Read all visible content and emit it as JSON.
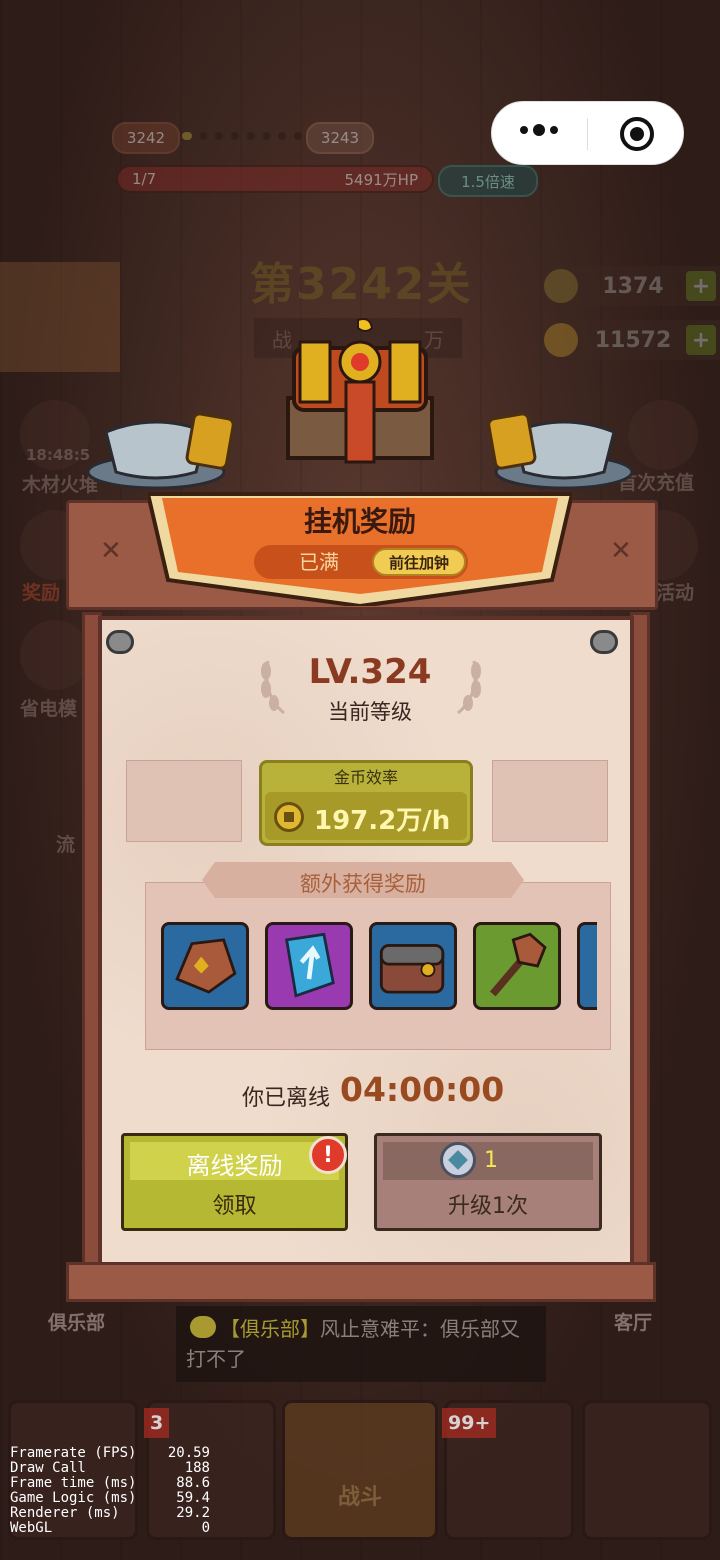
{
  "hud": {
    "level_current": "3242",
    "level_next": "3243",
    "wave": "1/7",
    "hp": "5491万HP",
    "speed": "1.5倍速",
    "stage_title": "第3242关",
    "stage_sub_left": "战",
    "stage_sub_right": "万",
    "currency_gold": "1374",
    "currency_bone": "11572",
    "side_left": [
      {
        "label": "木材火堆",
        "timer": "18:48:5"
      },
      {
        "label": "奖励"
      },
      {
        "label": "省电模"
      },
      {
        "label": "流"
      }
    ],
    "side_right": [
      {
        "label": "首次充值"
      },
      {
        "label": "活动"
      }
    ]
  },
  "modal": {
    "title": "挂机奖励",
    "full_label": "已满",
    "clock_button": "前往加钟",
    "level": "LV.324",
    "level_sub": "当前等级",
    "gold_rate_label": "金币效率",
    "gold_rate_value": "197.2万/h",
    "extra_title": "额外获得奖励",
    "items": [
      {
        "name": "ore-icon",
        "bg": "#2a6aa0"
      },
      {
        "name": "rune-stone-icon",
        "bg": "#9a3ab0"
      },
      {
        "name": "treasure-chest-icon",
        "bg": "#2a6aa0"
      },
      {
        "name": "torch-icon",
        "bg": "#6a9a30"
      },
      {
        "name": "partial-item-icon",
        "bg": "#2a6aa0"
      }
    ],
    "offline_label": "你已离线",
    "offline_time": "04:00:00",
    "offline_reward_label": "离线奖励",
    "claim_label": "领取",
    "alert_mark": "!",
    "gem_count": "1",
    "upgrade_label": "升级1次"
  },
  "bottom": {
    "club_label": "俱乐部",
    "lobby_label": "客厅",
    "chat_tag": "【俱乐部】",
    "chat_text": "风止意难平：俱乐部又打不了",
    "nav_badge_left": "3",
    "nav_battle": "战斗",
    "nav_badge_right": "99+"
  },
  "debug": [
    {
      "k": "Framerate (FPS)",
      "v": "20.59"
    },
    {
      "k": "Draw Call",
      "v": "188"
    },
    {
      "k": "Frame time (ms)",
      "v": "88.6"
    },
    {
      "k": "Game Logic (ms)",
      "v": "59.4"
    },
    {
      "k": "Renderer (ms)",
      "v": "29.2"
    },
    {
      "k": "WebGL",
      "v": "0"
    }
  ]
}
